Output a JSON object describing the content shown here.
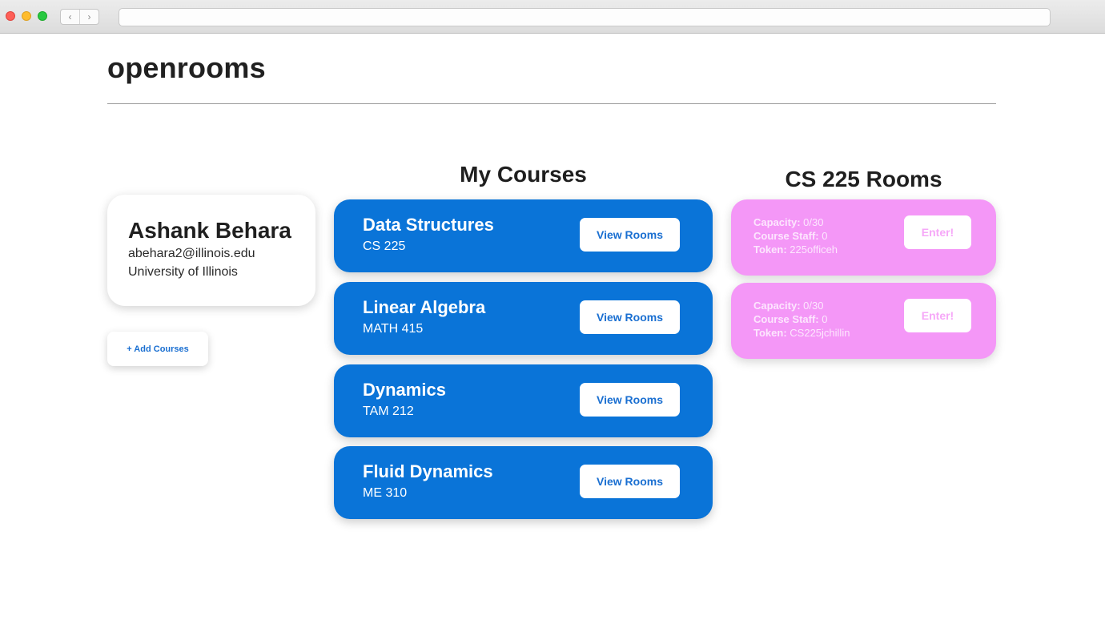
{
  "app": {
    "title": "openrooms"
  },
  "profile": {
    "name": "Ashank Behara",
    "email": "abehara2@illinois.edu",
    "university": "University of Illinois"
  },
  "actions": {
    "add_courses": "+ Add Courses"
  },
  "courses": {
    "title": "My Courses",
    "items": [
      {
        "name": "Data Structures",
        "code": "CS 225",
        "button": "View Rooms"
      },
      {
        "name": "Linear Algebra",
        "code": "MATH 415",
        "button": "View Rooms"
      },
      {
        "name": "Dynamics",
        "code": "TAM 212",
        "button": "View Rooms"
      },
      {
        "name": "Fluid Dynamics",
        "code": "ME 310",
        "button": "View Rooms"
      }
    ]
  },
  "rooms": {
    "title": "CS 225 Rooms",
    "capacity_label": "Capacity:",
    "staff_label": "Course Staff:",
    "token_label": "Token:",
    "items": [
      {
        "capacity": "0/30",
        "staff": "0",
        "token": "225officeh",
        "button": "Enter!"
      },
      {
        "capacity": "0/30",
        "staff": "0",
        "token": "CS225jchillin",
        "button": "Enter!"
      }
    ]
  },
  "colors": {
    "course_card": "#0a74d8",
    "room_card": "#f497f7",
    "link_blue": "#1a6fd1"
  },
  "icons": {
    "back": "chevron-left-icon",
    "forward": "chevron-right-icon"
  }
}
